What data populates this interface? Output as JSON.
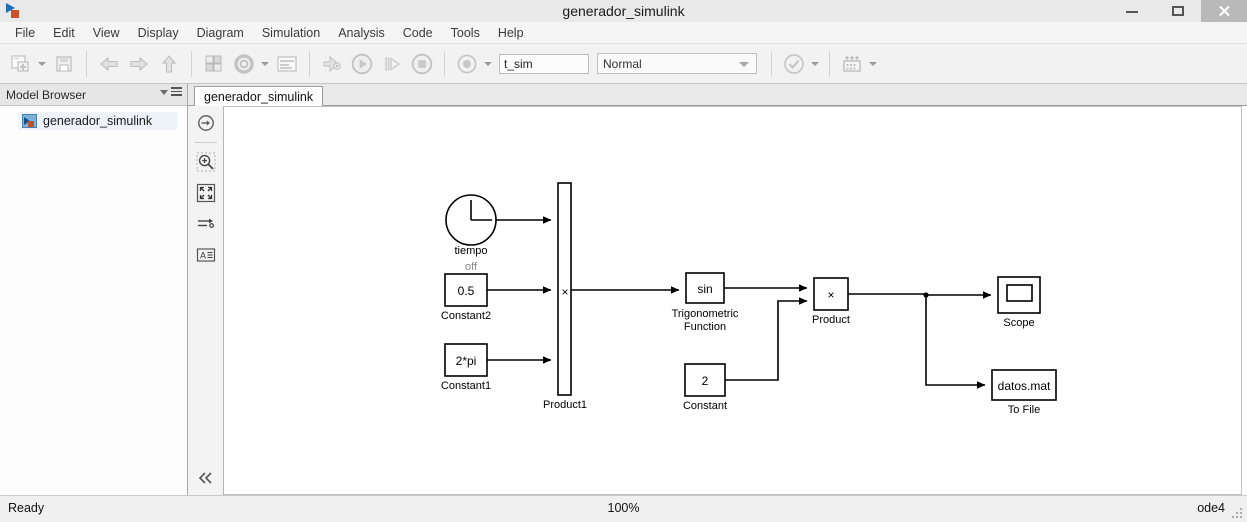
{
  "window": {
    "title": "generador_simulink",
    "app_icon": "simulink-icon",
    "controls": {
      "minimize": "minimize",
      "maximize": "maximize",
      "close": "close"
    }
  },
  "menu": {
    "items": [
      {
        "label": "File"
      },
      {
        "label": "Edit"
      },
      {
        "label": "View"
      },
      {
        "label": "Display"
      },
      {
        "label": "Diagram"
      },
      {
        "label": "Simulation"
      },
      {
        "label": "Analysis"
      },
      {
        "label": "Code"
      },
      {
        "label": "Tools"
      },
      {
        "label": "Help"
      }
    ]
  },
  "toolbar": {
    "new_model": "new-model-icon",
    "save": "save-icon",
    "back": "back-arrow-icon",
    "forward": "forward-arrow-icon",
    "up": "up-arrow-icon",
    "library_browser": "library-browser-icon",
    "model_settings": "gear-icon",
    "model_explorer": "model-explorer-icon",
    "update_diagram": "update-diagram-icon",
    "run": "run-icon",
    "step_forward": "step-forward-icon",
    "stop": "stop-icon",
    "record": "record-icon",
    "stop_time_value": "t_sim",
    "sim_mode_value": "Normal",
    "check_icon": "check-circle-icon",
    "build_icon": "build-icon"
  },
  "browser": {
    "title": "Model Browser",
    "menu_icon": "browser-menu-icon",
    "tree": [
      {
        "label": "generador_simulink",
        "icon": "simulink-model-icon"
      }
    ]
  },
  "canvas_tab": {
    "label": "generador_simulink"
  },
  "palette": {
    "items": [
      {
        "name": "navigate-icon"
      },
      {
        "name": "zoom-in-icon"
      },
      {
        "name": "fit-to-view-icon"
      },
      {
        "name": "signal-routing-icon"
      },
      {
        "name": "annotation-icon"
      }
    ],
    "collapse": "collapse-chevron-icon"
  },
  "model": {
    "blocks": [
      {
        "id": "clock",
        "type": "Clock",
        "label": "tiempo",
        "sublabel": "off",
        "value": ""
      },
      {
        "id": "constant2",
        "type": "Constant",
        "label": "Constant2",
        "value": "0.5"
      },
      {
        "id": "constant1",
        "type": "Constant",
        "label": "Constant1",
        "value": "2*pi"
      },
      {
        "id": "product1",
        "type": "Product",
        "label": "Product1",
        "value": "×"
      },
      {
        "id": "trig",
        "type": "Trigonometric Function",
        "label": "Trigonometric Function",
        "value": "sin"
      },
      {
        "id": "constant",
        "type": "Constant",
        "label": "Constant",
        "value": "2"
      },
      {
        "id": "product",
        "type": "Product",
        "label": "Product",
        "value": "×"
      },
      {
        "id": "scope",
        "type": "Scope",
        "label": "Scope",
        "value": ""
      },
      {
        "id": "tofile",
        "type": "To File",
        "label": "To File",
        "value": "datos.mat"
      }
    ]
  },
  "status": {
    "ready": "Ready",
    "zoom": "100%",
    "solver": "ode4"
  }
}
